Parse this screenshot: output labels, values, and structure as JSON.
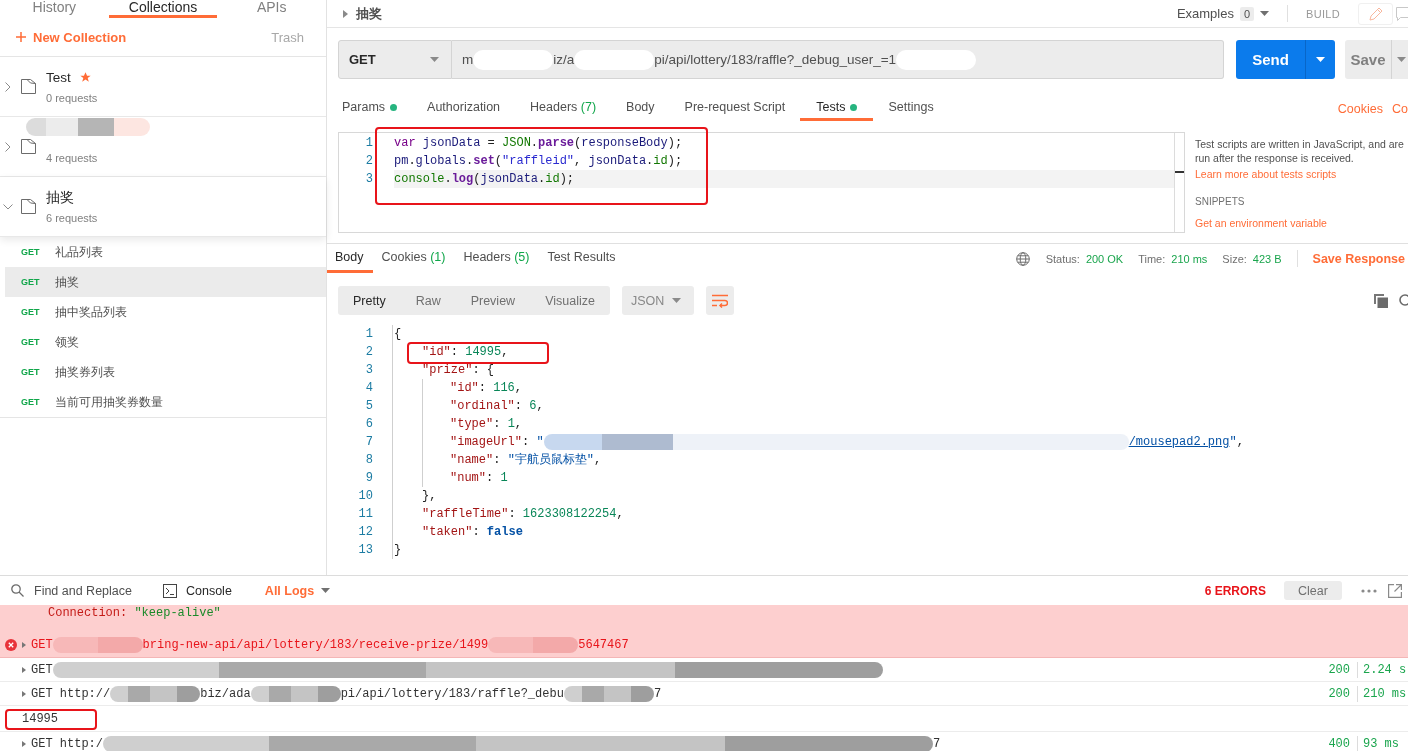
{
  "sidebar": {
    "tabs": [
      {
        "label": "History",
        "selected": false
      },
      {
        "label": "Collections",
        "selected": true
      },
      {
        "label": "APIs",
        "selected": false
      }
    ],
    "new_collection": "New Collection",
    "trash": "Trash",
    "collections": [
      {
        "name": "Test",
        "redacted": false,
        "starred": true,
        "count": "0 requests",
        "expanded": false
      },
      {
        "redacted": true,
        "starred": false,
        "count": "4 requests",
        "expanded": false
      },
      {
        "name": "抽奖",
        "redacted": false,
        "starred": false,
        "count": "6 requests",
        "expanded": true,
        "requests": [
          {
            "method": "GET",
            "name": "礼品列表",
            "selected": false
          },
          {
            "method": "GET",
            "name": "抽奖",
            "selected": true
          },
          {
            "method": "GET",
            "name": "抽中奖品列表",
            "selected": false
          },
          {
            "method": "GET",
            "name": "领奖",
            "selected": false
          },
          {
            "method": "GET",
            "name": "抽奖券列表",
            "selected": false
          },
          {
            "method": "GET",
            "name": "当前可用抽奖券数量",
            "selected": false
          }
        ]
      }
    ]
  },
  "request": {
    "title": "抽奖",
    "examples": {
      "label": "Examples",
      "count": "0"
    },
    "mode": "BUILD",
    "method": "GET",
    "url": [
      {
        "kind": "text",
        "text": "m"
      },
      {
        "kind": "redacted"
      },
      {
        "kind": "text",
        "text": "iz/a"
      },
      {
        "kind": "redacted"
      },
      {
        "kind": "text",
        "text": "pi/api/lottery/183/raffle?_debug_user_=1"
      },
      {
        "kind": "redacted"
      }
    ],
    "send": "Send",
    "save": "Save",
    "tabs": [
      {
        "label": "Params",
        "dot": true,
        "selected": false
      },
      {
        "label": "Authorization",
        "dot": false,
        "selected": false
      },
      {
        "label": "Headers",
        "count": "(7)",
        "dot": false,
        "selected": false
      },
      {
        "label": "Body",
        "dot": false,
        "selected": false
      },
      {
        "label": "Pre-request Script",
        "dot": false,
        "selected": false
      },
      {
        "label": "Tests",
        "dot": true,
        "selected": true
      },
      {
        "label": "Settings",
        "dot": false,
        "selected": false
      }
    ],
    "links": [
      "Cookies",
      "Co"
    ],
    "tests_editor": {
      "annotated": true,
      "lines": [
        {
          "number": "1",
          "active": false,
          "tokens": [
            {
              "kind": "kw",
              "text": "var "
            },
            {
              "kind": "var",
              "text": "jsonData"
            },
            {
              "kind": "punct",
              "text": " = "
            },
            {
              "kind": "builtin",
              "text": "JSON"
            },
            {
              "kind": "punct",
              "text": "."
            },
            {
              "kind": "method",
              "text": "parse"
            },
            {
              "kind": "punct",
              "text": "("
            },
            {
              "kind": "var",
              "text": "responseBody"
            },
            {
              "kind": "punct",
              "text": ");"
            }
          ]
        },
        {
          "number": "2",
          "active": false,
          "tokens": [
            {
              "kind": "var",
              "text": "pm"
            },
            {
              "kind": "punct",
              "text": "."
            },
            {
              "kind": "var",
              "text": "globals"
            },
            {
              "kind": "punct",
              "text": "."
            },
            {
              "kind": "method",
              "text": "set"
            },
            {
              "kind": "punct",
              "text": "("
            },
            {
              "kind": "str",
              "text": "\"raffleid\""
            },
            {
              "kind": "punct",
              "text": ", "
            },
            {
              "kind": "var",
              "text": "jsonData"
            },
            {
              "kind": "punct",
              "text": "."
            },
            {
              "kind": "builtin",
              "text": "id"
            },
            {
              "kind": "punct",
              "text": ");"
            }
          ]
        },
        {
          "number": "3",
          "active": true,
          "tokens": [
            {
              "kind": "builtin",
              "text": "console"
            },
            {
              "kind": "punct",
              "text": "."
            },
            {
              "kind": "method",
              "text": "log"
            },
            {
              "kind": "punct",
              "text": "("
            },
            {
              "kind": "var",
              "text": "jsonData"
            },
            {
              "kind": "punct",
              "text": "."
            },
            {
              "kind": "builtin",
              "text": "id"
            },
            {
              "kind": "punct",
              "text": ");"
            }
          ]
        }
      ]
    },
    "help": {
      "text": "Test scripts are written in JavaScript, and are run after the response is received.",
      "link": "Learn more about tests scripts",
      "snippets_title": "SNIPPETS",
      "snippets": [
        "Get an environment variable"
      ]
    }
  },
  "response": {
    "tabs": [
      {
        "label": "Body",
        "selected": true
      },
      {
        "label": "Cookies",
        "count": "(1)",
        "selected": false
      },
      {
        "label": "Headers",
        "count": "(5)",
        "selected": false
      },
      {
        "label": "Test Results",
        "selected": false
      }
    ],
    "meta": [
      {
        "label": "Status:",
        "value": "200 OK"
      },
      {
        "label": "Time:",
        "value": "210 ms"
      },
      {
        "label": "Size:",
        "value": "423 B"
      }
    ],
    "save": "Save Response",
    "views": [
      {
        "label": "Pretty",
        "selected": true
      },
      {
        "label": "Raw",
        "selected": false
      },
      {
        "label": "Preview",
        "selected": false
      },
      {
        "label": "Visualize",
        "selected": false
      }
    ],
    "format": "JSON",
    "body_lines": [
      {
        "number": "1",
        "annotated": false,
        "tokens": [
          {
            "kind": "punct",
            "text": "{"
          }
        ],
        "children": [
          {
            "number": "2",
            "annotated": true,
            "tokens": [
              {
                "kind": "key",
                "text": "\"id\""
              },
              {
                "kind": "punct",
                "text": ": "
              },
              {
                "kind": "num",
                "text": "14995"
              },
              {
                "kind": "punct",
                "text": ","
              }
            ]
          },
          {
            "number": "3",
            "annotated": false,
            "tokens": [
              {
                "kind": "key",
                "text": "\"prize\""
              },
              {
                "kind": "punct",
                "text": ": {"
              }
            ],
            "children": [
              {
                "number": "4",
                "annotated": false,
                "tokens": [
                  {
                    "kind": "key",
                    "text": "\"id\""
                  },
                  {
                    "kind": "punct",
                    "text": ": "
                  },
                  {
                    "kind": "num",
                    "text": "116"
                  },
                  {
                    "kind": "punct",
                    "text": ","
                  }
                ]
              },
              {
                "number": "5",
                "annotated": false,
                "tokens": [
                  {
                    "kind": "key",
                    "text": "\"ordinal\""
                  },
                  {
                    "kind": "punct",
                    "text": ": "
                  },
                  {
                    "kind": "num",
                    "text": "6"
                  },
                  {
                    "kind": "punct",
                    "text": ","
                  }
                ]
              },
              {
                "number": "6",
                "annotated": false,
                "tokens": [
                  {
                    "kind": "key",
                    "text": "\"type\""
                  },
                  {
                    "kind": "punct",
                    "text": ": "
                  },
                  {
                    "kind": "num",
                    "text": "1"
                  },
                  {
                    "kind": "punct",
                    "text": ","
                  }
                ]
              },
              {
                "number": "7",
                "annotated": false,
                "tokens": [
                  {
                    "kind": "key",
                    "text": "\"imageUrl\""
                  },
                  {
                    "kind": "punct",
                    "text": ": "
                  },
                  {
                    "kind": "str",
                    "text": "\""
                  },
                  {
                    "kind": "redacted"
                  },
                  {
                    "kind": "link",
                    "text": "/mousepad2.png"
                  },
                  {
                    "kind": "str",
                    "text": "\""
                  },
                  {
                    "kind": "punct",
                    "text": ","
                  }
                ]
              },
              {
                "number": "8",
                "annotated": false,
                "tokens": [
                  {
                    "kind": "key",
                    "text": "\"name\""
                  },
                  {
                    "kind": "punct",
                    "text": ": "
                  },
                  {
                    "kind": "str",
                    "text": "\"宇航员鼠标垫\""
                  },
                  {
                    "kind": "punct",
                    "text": ","
                  }
                ]
              },
              {
                "number": "9",
                "annotated": false,
                "tokens": [
                  {
                    "kind": "key",
                    "text": "\"num\""
                  },
                  {
                    "kind": "punct",
                    "text": ": "
                  },
                  {
                    "kind": "num",
                    "text": "1"
                  }
                ]
              }
            ]
          },
          {
            "number": "10",
            "annotated": false,
            "tokens": [
              {
                "kind": "punct",
                "text": "},"
              }
            ]
          },
          {
            "number": "11",
            "annotated": false,
            "tokens": [
              {
                "kind": "key",
                "text": "\"raffleTime\""
              },
              {
                "kind": "punct",
                "text": ": "
              },
              {
                "kind": "num",
                "text": "1623308122254"
              },
              {
                "kind": "punct",
                "text": ","
              }
            ]
          },
          {
            "number": "12",
            "annotated": false,
            "tokens": [
              {
                "kind": "key",
                "text": "\"taken\""
              },
              {
                "kind": "punct",
                "text": ": "
              },
              {
                "kind": "bool",
                "text": "false"
              }
            ]
          }
        ]
      },
      {
        "number": "13",
        "annotated": false,
        "tokens": [
          {
            "kind": "punct",
            "text": "}"
          }
        ]
      }
    ]
  },
  "console": {
    "find": "Find and Replace",
    "console": "Console",
    "filter": "All Logs",
    "errors": "6 ERRORS",
    "clear": "Clear",
    "lines": [
      {
        "kind": "header",
        "annotated": false,
        "segments": [
          {
            "kind": "key",
            "text": "Connection:"
          },
          {
            "kind": "value",
            "text": "\"keep-alive\""
          }
        ]
      },
      {
        "kind": "error",
        "annotated": false,
        "segments": [
          {
            "kind": "text",
            "text": "GET"
          },
          {
            "kind": "redacted"
          },
          {
            "kind": "text",
            "text": "bring-new-api/api/lottery/183/receive-prize/1499"
          },
          {
            "kind": "redacted"
          },
          {
            "kind": "text",
            "text": "5647467"
          }
        ]
      },
      {
        "kind": "request",
        "annotated": false,
        "segments": [
          {
            "kind": "text",
            "text": "GET"
          },
          {
            "kind": "redacted"
          }
        ],
        "status": "200",
        "time": "2.24 s"
      },
      {
        "kind": "request",
        "annotated": false,
        "segments": [
          {
            "kind": "text",
            "text": "GET http://"
          },
          {
            "kind": "redacted"
          },
          {
            "kind": "text",
            "text": "biz/ada"
          },
          {
            "kind": "redacted"
          },
          {
            "kind": "text",
            "text": "pi/api/lottery/183/raffle?_debu"
          },
          {
            "kind": "redacted"
          },
          {
            "kind": "text",
            "text": "7"
          }
        ],
        "status": "200",
        "time": "210 ms"
      },
      {
        "kind": "log",
        "annotated": true,
        "segments": [
          {
            "kind": "text",
            "text": "14995"
          }
        ]
      },
      {
        "kind": "request",
        "annotated": false,
        "segments": [
          {
            "kind": "text",
            "text": "GET http:/"
          },
          {
            "kind": "redacted"
          },
          {
            "kind": "text",
            "text": "7"
          }
        ],
        "status": "400",
        "time": "93 ms"
      }
    ]
  }
}
